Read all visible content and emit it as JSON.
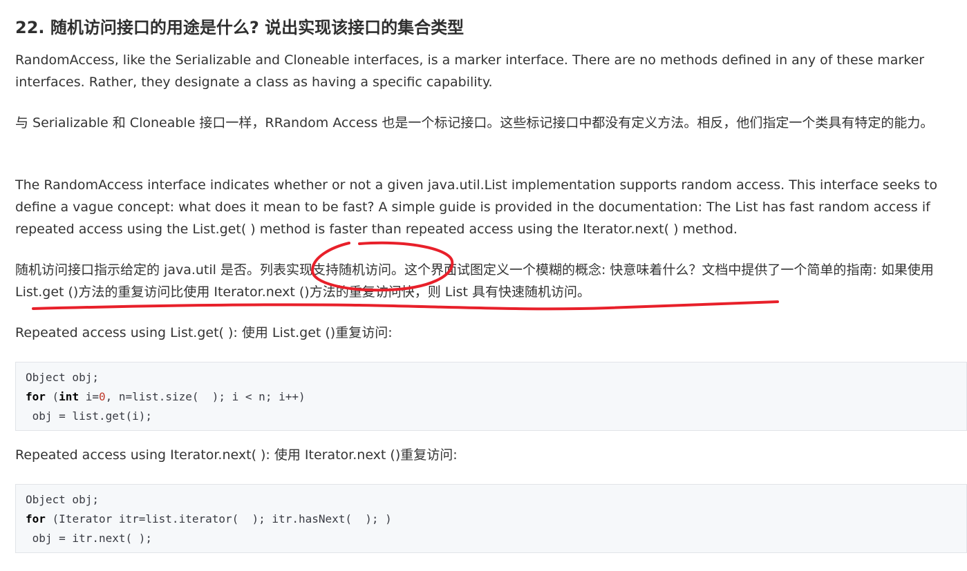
{
  "heading": "22. 随机访问接口的用途是什么? 说出实现该接口的集合类型",
  "paragraphs": {
    "p1": "RandomAccess, like the Serializable and Cloneable interfaces, is a marker interface. There are no methods defined in any of these marker interfaces. Rather, they designate a class as having a specific capability.",
    "p2": "与 Serializable 和 Cloneable 接口一样，RRandom Access 也是一个标记接口。这些标记接口中都没有定义方法。相反，他们指定一个类具有特定的能力。",
    "p3": "The RandomAccess interface indicates whether or not a given java.util.List implementation supports random access. This interface seeks to define a vague concept: what does it mean to be fast? A simple guide is provided in the documentation: The List has fast random access if repeated access using the List.get( ) method is faster than repeated access using the Iterator.next( ) method.",
    "p4": "随机访问接口指示给定的 java.util 是否。列表实现支持随机访问。这个界面试图定义一个模糊的概念: 快意味着什么？文档中提供了一个简单的指南: 如果使用 List.get ()方法的重复访问比使用 Iterator.next ()方法的重复访问快，则 List 具有快速随机访问。",
    "p5": "Repeated access using List.get( ):  使用 List.get ()重复访问:",
    "p6": "Repeated access using Iterator.next( ):  使用 Iterator.next ()重复访问:"
  },
  "code1": {
    "line1": "Object obj;",
    "line2_kw": "for",
    "line2_a": " (",
    "line2_kw2": "int",
    "line2_b": " i=",
    "line2_num": "0",
    "line2_c": ", n=list.size(  ); i < n; i++)",
    "line3": " obj = list.get(i);"
  },
  "code2": {
    "line1": "Object obj;",
    "line2_kw": "for",
    "line2_rest": " (Iterator itr=list.iterator(  ); itr.hasNext(  ); )",
    "line3": " obj = itr.next( );"
  },
  "colors": {
    "text": "#333333",
    "code_bg": "#f6f8fa",
    "annotation": "#e8202a"
  }
}
